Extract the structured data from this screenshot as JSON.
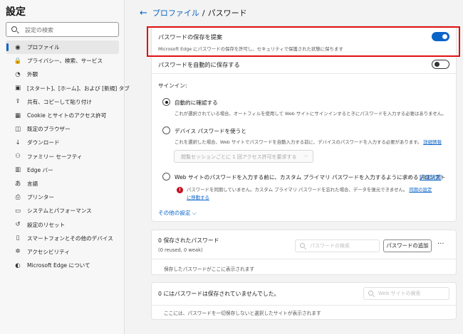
{
  "sidebar": {
    "title": "設定",
    "search_placeholder": "設定の検索",
    "items": [
      {
        "label": "プロファイル",
        "icon": "profile-icon",
        "glyph": "◉",
        "active": true
      },
      {
        "label": "プライバシー、検索、サービス",
        "icon": "lock-icon",
        "glyph": "🔒"
      },
      {
        "label": "外観",
        "icon": "appearance-icon",
        "glyph": "◔"
      },
      {
        "label": "[スタート]、[ホーム]、および [新規] タブ",
        "icon": "tabs-icon",
        "glyph": "▣"
      },
      {
        "label": "共有、コピーして貼り付け",
        "icon": "share-icon",
        "glyph": "⇪"
      },
      {
        "label": "Cookie とサイトのアクセス許可",
        "icon": "cookie-icon",
        "glyph": "▦"
      },
      {
        "label": "既定のブラウザー",
        "icon": "browser-icon",
        "glyph": "◫"
      },
      {
        "label": "ダウンロード",
        "icon": "download-icon",
        "glyph": "↓"
      },
      {
        "label": "ファミリー セーフティ",
        "icon": "family-icon",
        "glyph": "⚇"
      },
      {
        "label": "Edge バー",
        "icon": "edge-bar-icon",
        "glyph": "▥"
      },
      {
        "label": "言語",
        "icon": "language-icon",
        "glyph": "あ"
      },
      {
        "label": "プリンター",
        "icon": "printer-icon",
        "glyph": "⎙"
      },
      {
        "label": "システムとパフォーマンス",
        "icon": "system-icon",
        "glyph": "▭"
      },
      {
        "label": "設定のリセット",
        "icon": "reset-icon",
        "glyph": "↺"
      },
      {
        "label": "スマートフォンとその他のデバイス",
        "icon": "phone-icon",
        "glyph": "▯"
      },
      {
        "label": "アクセシビリティ",
        "icon": "accessibility-icon",
        "glyph": "✲"
      },
      {
        "label": "Microsoft Edge について",
        "icon": "edge-logo-icon",
        "glyph": "◐"
      }
    ]
  },
  "header": {
    "back_glyph": "←",
    "parent": "プロファイル",
    "separator": "/",
    "current": "パスワード"
  },
  "settings": {
    "offer_save": {
      "title": "パスワードの保存を提案",
      "desc": "Microsoft Edge にパスワードの保存を許可し、セキュリティで保護された状態に保ちます",
      "enabled": true
    },
    "auto_save": {
      "title": "パスワードを自動的に保存する",
      "enabled": false
    },
    "signin": {
      "heading": "サインイン:",
      "option_auto": {
        "title": "自動的に確認する",
        "desc": "これが選択されている場合、オートフィルを使用して Web サイトにサインインするときにパスワードを入力する必要はありません。",
        "selected": true
      },
      "option_device": {
        "title": "デバイス パスワードを使うと",
        "desc": "これを選択した場合、Web サイトでパスワードを自動入力する前に、デバイスのパスワードを入力する必要があります。",
        "link": "詳細情報",
        "select_value": "閲覧セッションごとに 1 回アクセス許可を要求する",
        "selected": false
      },
      "option_primary": {
        "title": "Web サイトのパスワードを入力する前に、カスタム プライマリ パスワードを入力するように求めるプロンプト",
        "link": "詳細情報",
        "warning": "パスワードを同期していません。カスタム プライマリ パスワードを忘れた場合、データを復元できません。",
        "warning_link_1": "同期の設定",
        "warning_link_2": "に移動する",
        "selected": false
      }
    },
    "more_settings": "その他の設定"
  },
  "saved_passwords": {
    "title": "0 保存されたパスワード",
    "subtitle": "(0 reused, 0 weak)",
    "search_placeholder": "パスワードの検索",
    "add_button": "パスワードの追加",
    "more_glyph": "···",
    "empty_text": "保存したパスワードがここに表示されます"
  },
  "never_saved": {
    "title": "0 にはパスワードは保存されていませんでした。",
    "search_placeholder": "Web サイトの検索",
    "empty_text": "ここには、パスワードを一切保存しないと選択したサイトが表示されます"
  },
  "colors": {
    "accent": "#0a64c8",
    "highlight": "#e01010",
    "error": "#c50f1f"
  }
}
